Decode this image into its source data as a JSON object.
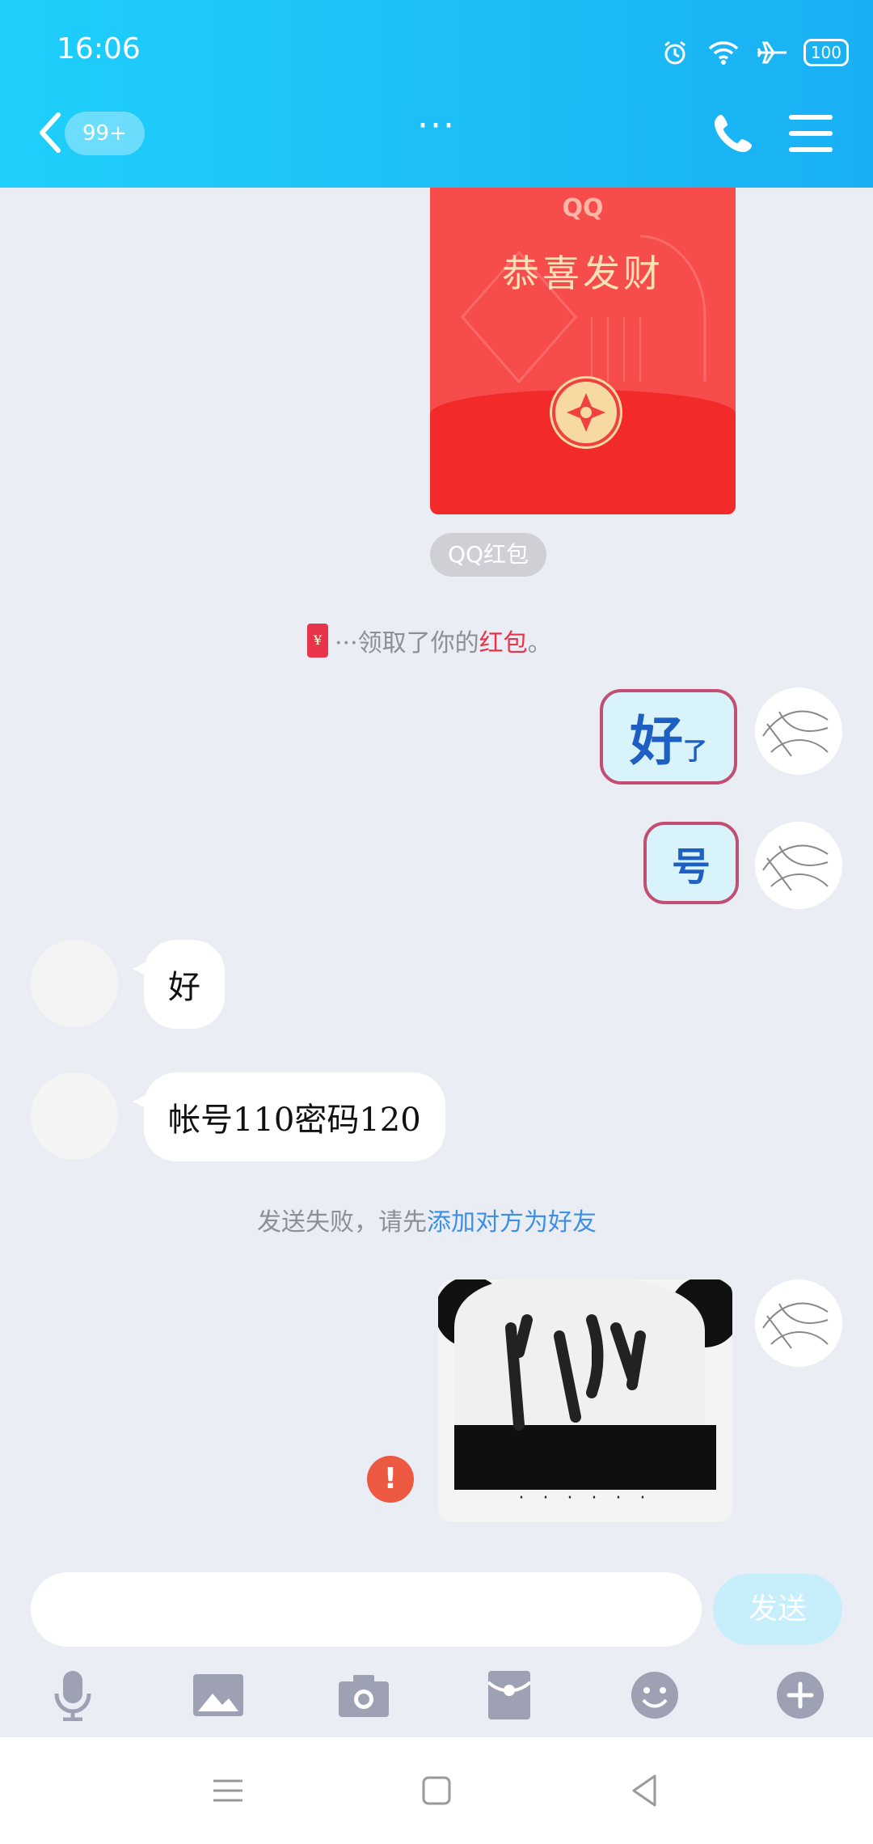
{
  "status_bar": {
    "time": "16:06",
    "battery": "100"
  },
  "header": {
    "unread_badge": "99+",
    "title": "···"
  },
  "red_packet": {
    "brand": "QQ",
    "greeting": "恭喜发财",
    "tag": "QQ红包"
  },
  "notice_received": {
    "prefix": "···领取了你的",
    "link": "红包",
    "suffix": "。"
  },
  "stickers": [
    {
      "big": "好",
      "small": "了"
    },
    {
      "big": "号"
    }
  ],
  "messages": [
    {
      "text": "好"
    },
    {
      "text": "帐号110密码120"
    }
  ],
  "notice_failed": {
    "prefix": "发送失败，请先",
    "link": "添加对方为好友"
  },
  "panda_image": {
    "caption": "· · · · · ·"
  },
  "input": {
    "placeholder": "",
    "value": ""
  },
  "send_button": {
    "label": "发送"
  },
  "fail_indicator": "!",
  "colors": {
    "header": "#19b0f3",
    "red_packet": "#f64c4c",
    "link": "#3d8fe6",
    "error": "#ed5840"
  }
}
